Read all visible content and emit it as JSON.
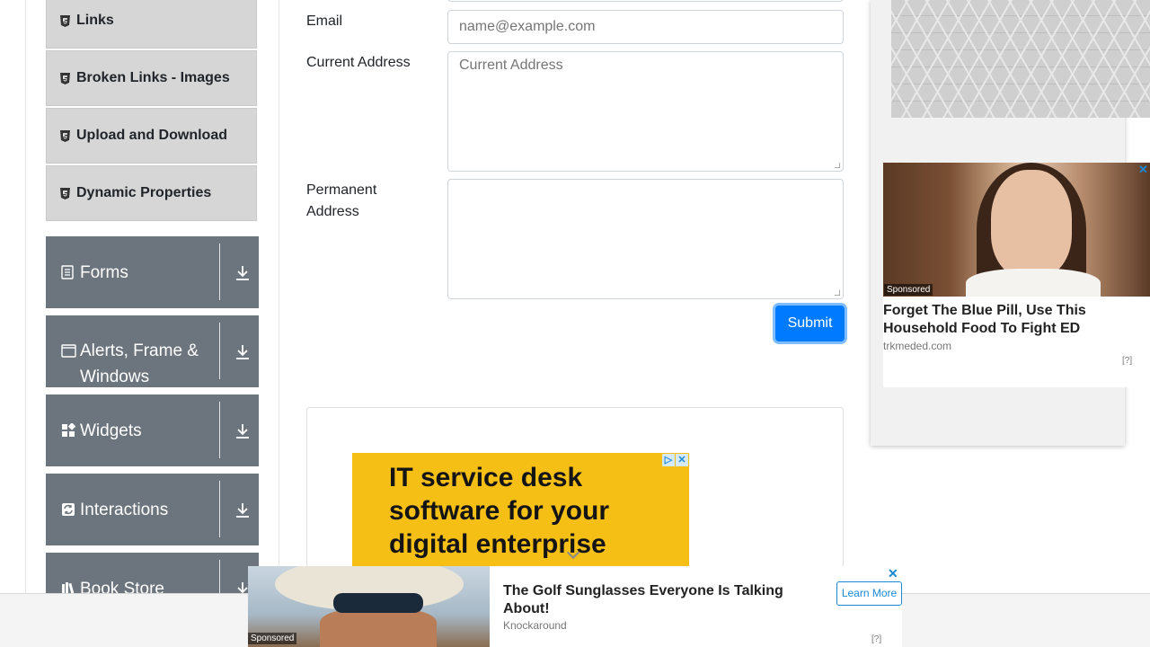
{
  "sidebar": {
    "sub_items": [
      {
        "label": "Links"
      },
      {
        "label": "Broken Links - Images"
      },
      {
        "label": "Upload and Download"
      },
      {
        "label": "Dynamic Properties"
      }
    ],
    "groups": [
      {
        "label": "Forms",
        "icon": "form-icon"
      },
      {
        "label": "Alerts, Frame & Windows",
        "icon": "window-icon"
      },
      {
        "label": "Widgets",
        "icon": "widgets-icon"
      },
      {
        "label": "Interactions",
        "icon": "interactions-icon"
      },
      {
        "label": "Book Store Application",
        "icon": "books-icon"
      }
    ]
  },
  "form": {
    "email_label": "Email",
    "email_placeholder": "name@example.com",
    "current_address_label": "Current Address",
    "current_address_placeholder": "Current Address",
    "permanent_address_label": "Permanent Address",
    "submit_label": "Submit"
  },
  "ads": {
    "it_ad_text": "IT service desk software for your digital enterprise",
    "ed_ad": {
      "sponsored": "Sponsored",
      "title": "Forget The Blue Pill, Use This Household Food To Fight ED",
      "source": "trkmeded.com",
      "help": "[?]"
    },
    "golf_ad": {
      "sponsored": "Sponsored",
      "title": "The Golf Sunglasses Everyone Is Talking About!",
      "source": "Knockaround",
      "cta": "Learn More",
      "help": "[?]"
    }
  },
  "colors": {
    "primary": "#007bff",
    "sidebar_group_bg": "#6c757d",
    "sidebar_item_bg": "#d6d6d6",
    "ad_yellow": "#f5bf16"
  }
}
